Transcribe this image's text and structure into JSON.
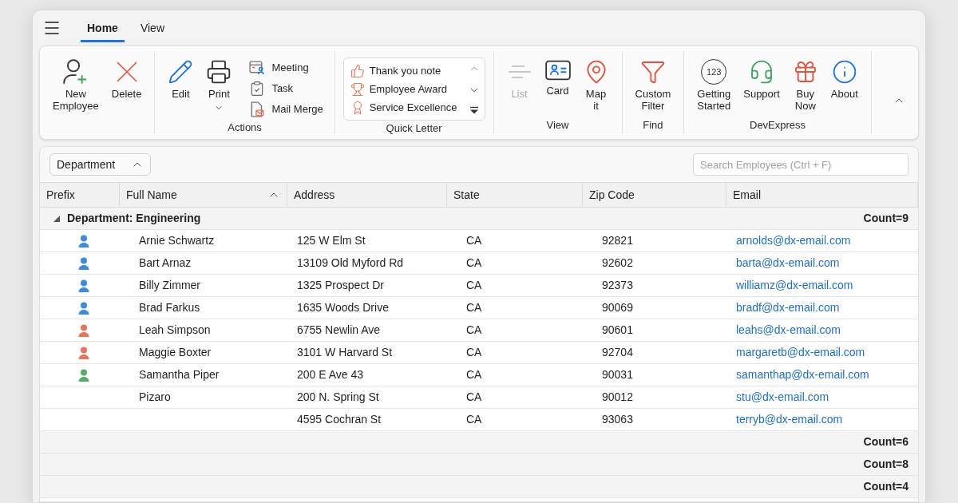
{
  "tabs": [
    {
      "label": "Home",
      "selected": true
    },
    {
      "label": "View",
      "selected": false
    }
  ],
  "ribbon": {
    "groups": [
      {
        "kind": "buttons",
        "items": [
          {
            "kind": "large",
            "label": "New Employee"
          },
          {
            "kind": "large",
            "label": "Delete"
          }
        ]
      },
      {
        "kind": "buttons",
        "label": "Actions",
        "items": [
          {
            "kind": "large",
            "label": "Edit"
          },
          {
            "kind": "large",
            "label": "Print",
            "dropdown": true
          },
          {
            "kind": "small",
            "label": "Meeting"
          },
          {
            "kind": "small",
            "label": "Task"
          },
          {
            "kind": "small",
            "label": "Mail Merge"
          }
        ]
      },
      {
        "kind": "gallery",
        "label": "Quick Letter",
        "items": [
          {
            "label": "Thank you note"
          },
          {
            "label": "Employee Award"
          },
          {
            "label": "Service Excellence"
          }
        ]
      },
      {
        "kind": "buttons",
        "label": "View",
        "items": [
          {
            "kind": "large",
            "label": "List",
            "disabled": true
          },
          {
            "kind": "large",
            "label": "Card",
            "disabled": false
          },
          {
            "kind": "large",
            "label": "Map it",
            "disabled": false
          }
        ]
      },
      {
        "kind": "buttons",
        "label": "Find",
        "items": [
          {
            "kind": "large",
            "label": "Custom Filter"
          }
        ]
      },
      {
        "kind": "buttons",
        "label": "DevExpress",
        "items": [
          {
            "kind": "large",
            "label": "Getting Started",
            "icon_text": "123"
          },
          {
            "kind": "large",
            "label": "Support"
          },
          {
            "kind": "large",
            "label": "Buy Now"
          },
          {
            "kind": "large",
            "label": "About"
          }
        ]
      }
    ]
  },
  "grid": {
    "group_panel": {
      "chips": [
        {
          "label": "Department",
          "sort_ascending": true
        }
      ]
    },
    "search": {
      "placeholder": "Search Employees (Ctrl + F)"
    },
    "columns": [
      {
        "label": "Prefix"
      },
      {
        "label": "Full Name",
        "sort_ascending": true
      },
      {
        "label": "Address"
      },
      {
        "label": "State"
      },
      {
        "label": "Zip Code"
      },
      {
        "label": "Email"
      }
    ],
    "groups": [
      {
        "title": "Department: Engineering",
        "expanded": true,
        "summary": "Count=9",
        "rows": [
          {
            "prefix": {
              "color": "#3b8ddb"
            },
            "full_name": "Arnie Schwartz",
            "address": "125 W Elm St",
            "state": "CA",
            "zip_code": "92821",
            "email": "arnolds@dx-email.com"
          },
          {
            "prefix": {
              "color": "#3b8ddb"
            },
            "full_name": "Bart Arnaz",
            "address": "13109 Old Myford Rd",
            "state": "CA",
            "zip_code": "92602",
            "email": "barta@dx-email.com"
          },
          {
            "prefix": {
              "color": "#3b8ddb"
            },
            "full_name": "Billy Zimmer",
            "address": "1325 Prospect Dr",
            "state": "CA",
            "zip_code": "92373",
            "email": "williamz@dx-email.com"
          },
          {
            "prefix": {
              "color": "#3b8ddb"
            },
            "full_name": "Brad Farkus",
            "address": "1635 Woods Drive",
            "state": "CA",
            "zip_code": "90069",
            "email": "bradf@dx-email.com"
          },
          {
            "prefix": {
              "color": "#e8765a"
            },
            "full_name": "Leah Simpson",
            "address": "6755 Newlin Ave",
            "state": "CA",
            "zip_code": "90601",
            "email": "leahs@dx-email.com"
          },
          {
            "prefix": {
              "color": "#e8765a"
            },
            "full_name": "Maggie Boxter",
            "address": "3101 W Harvard St",
            "state": "CA",
            "zip_code": "92704",
            "email": "margaretb@dx-email.com"
          },
          {
            "prefix": {
              "color": "#5aab6a"
            },
            "full_name": "Samantha Piper",
            "address": "200 E Ave 43",
            "state": "CA",
            "zip_code": "90031",
            "email": "samanthap@dx-email.com"
          },
          {
            "full_name": "Pizaro",
            "address": "200 N. Spring St",
            "state": "CA",
            "zip_code": "90012",
            "email": "stu@dx-email.com"
          },
          {
            "address": "4595 Cochran St",
            "state": "CA",
            "zip_code": "93063",
            "email": "terryb@dx-email.com"
          }
        ]
      },
      {
        "summary": "Count=6"
      },
      {
        "summary": "Count=8"
      },
      {
        "summary": "Count=4"
      }
    ]
  }
}
